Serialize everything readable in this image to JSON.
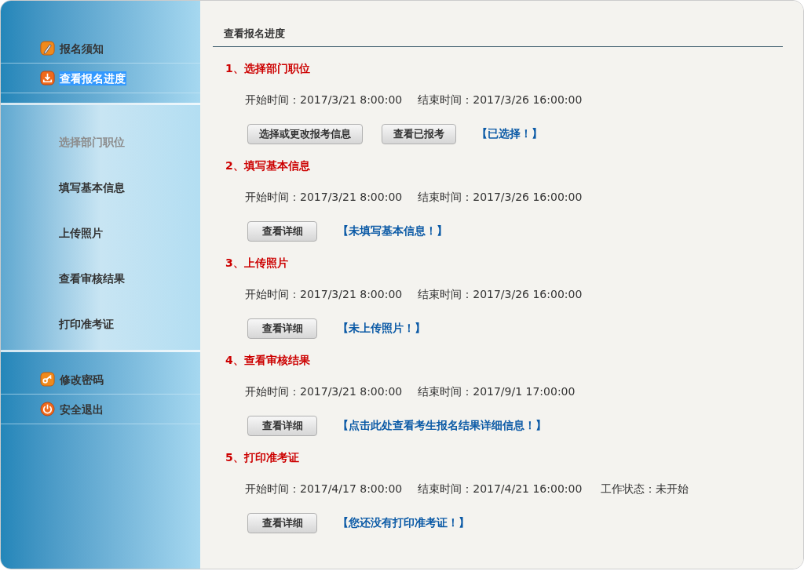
{
  "sidebar": {
    "top_items": [
      {
        "label": "报名须知",
        "selected": false
      },
      {
        "label": "查看报名进度",
        "selected": true
      }
    ],
    "sub_items": [
      {
        "label": "选择部门职位",
        "disabled": true
      },
      {
        "label": "填写基本信息",
        "disabled": false
      },
      {
        "label": "上传照片",
        "disabled": false
      },
      {
        "label": "查看审核结果",
        "disabled": false
      },
      {
        "label": "打印准考证",
        "disabled": false
      }
    ],
    "bottom_items": [
      {
        "label": "修改密码",
        "selected": false
      },
      {
        "label": "安全退出",
        "selected": false
      }
    ]
  },
  "main": {
    "title": "查看报名进度",
    "steps": [
      {
        "title": "1、选择部门职位",
        "start": "开始时间：2017/3/21 8:00:00",
        "end": "结束时间：2017/3/26 16:00:00",
        "buttons": [
          "选择或更改报考信息",
          "查看已报考"
        ],
        "status": "【已选择！】"
      },
      {
        "title": "2、填写基本信息",
        "start": "开始时间：2017/3/21 8:00:00",
        "end": "结束时间：2017/3/26 16:00:00",
        "buttons": [
          "查看详细"
        ],
        "status": "【未填写基本信息！】"
      },
      {
        "title": "3、上传照片",
        "start": "开始时间：2017/3/21 8:00:00",
        "end": "结束时间：2017/3/26 16:00:00",
        "buttons": [
          "查看详细"
        ],
        "status": "【未上传照片！】"
      },
      {
        "title": "4、查看审核结果",
        "start": "开始时间：2017/3/21 8:00:00",
        "end": "结束时间：2017/9/1 17:00:00",
        "buttons": [
          "查看详细"
        ],
        "status": "【点击此处查看考生报名结果详细信息！】"
      },
      {
        "title": "5、打印准考证",
        "start": "开始时间：2017/4/17 8:00:00",
        "end": "结束时间：2017/4/21 16:00:00",
        "work_state": "工作状态：未开始",
        "buttons": [
          "查看详细"
        ],
        "status": "【您还没有打印准考证！】"
      }
    ]
  }
}
